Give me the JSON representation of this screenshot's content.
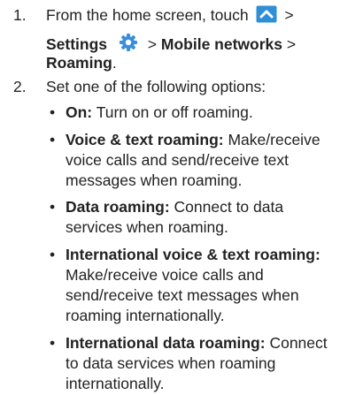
{
  "steps": [
    {
      "number": "1.",
      "line1_prefix": "From the home screen, touch",
      "line1_suffix": ">",
      "settings_label": "Settings",
      "sep1": ">",
      "mobile_networks": "Mobile networks",
      "sep2": ">",
      "roaming": "Roaming",
      "end_punct": ".",
      "icons": [
        "apps-arrow-icon",
        "settings-gear-icon"
      ],
      "colors": {
        "apps_icon": "#2f8fd6",
        "gear": "#3a8fdc"
      }
    },
    {
      "number": "2.",
      "text": "Set one of the following options:"
    }
  ],
  "bullet_marker": "•",
  "options": [
    {
      "label": "On:",
      "desc": "Turn on or off roaming."
    },
    {
      "label": "Voice & text roaming:",
      "desc_lines": [
        "Make/receive",
        "voice calls and send/receive text",
        "messages when roaming."
      ]
    },
    {
      "label": "Data roaming:",
      "desc_lines": [
        "Connect to data",
        "services when roaming."
      ]
    },
    {
      "label": "International voice & text roaming:",
      "desc_lines": [
        "Make/receive voice calls and",
        "send/receive text messages when",
        "roaming internationally."
      ]
    },
    {
      "label": "International data roaming:",
      "desc_lines": [
        "Connect",
        "to data services when roaming",
        "internationally."
      ]
    }
  ]
}
